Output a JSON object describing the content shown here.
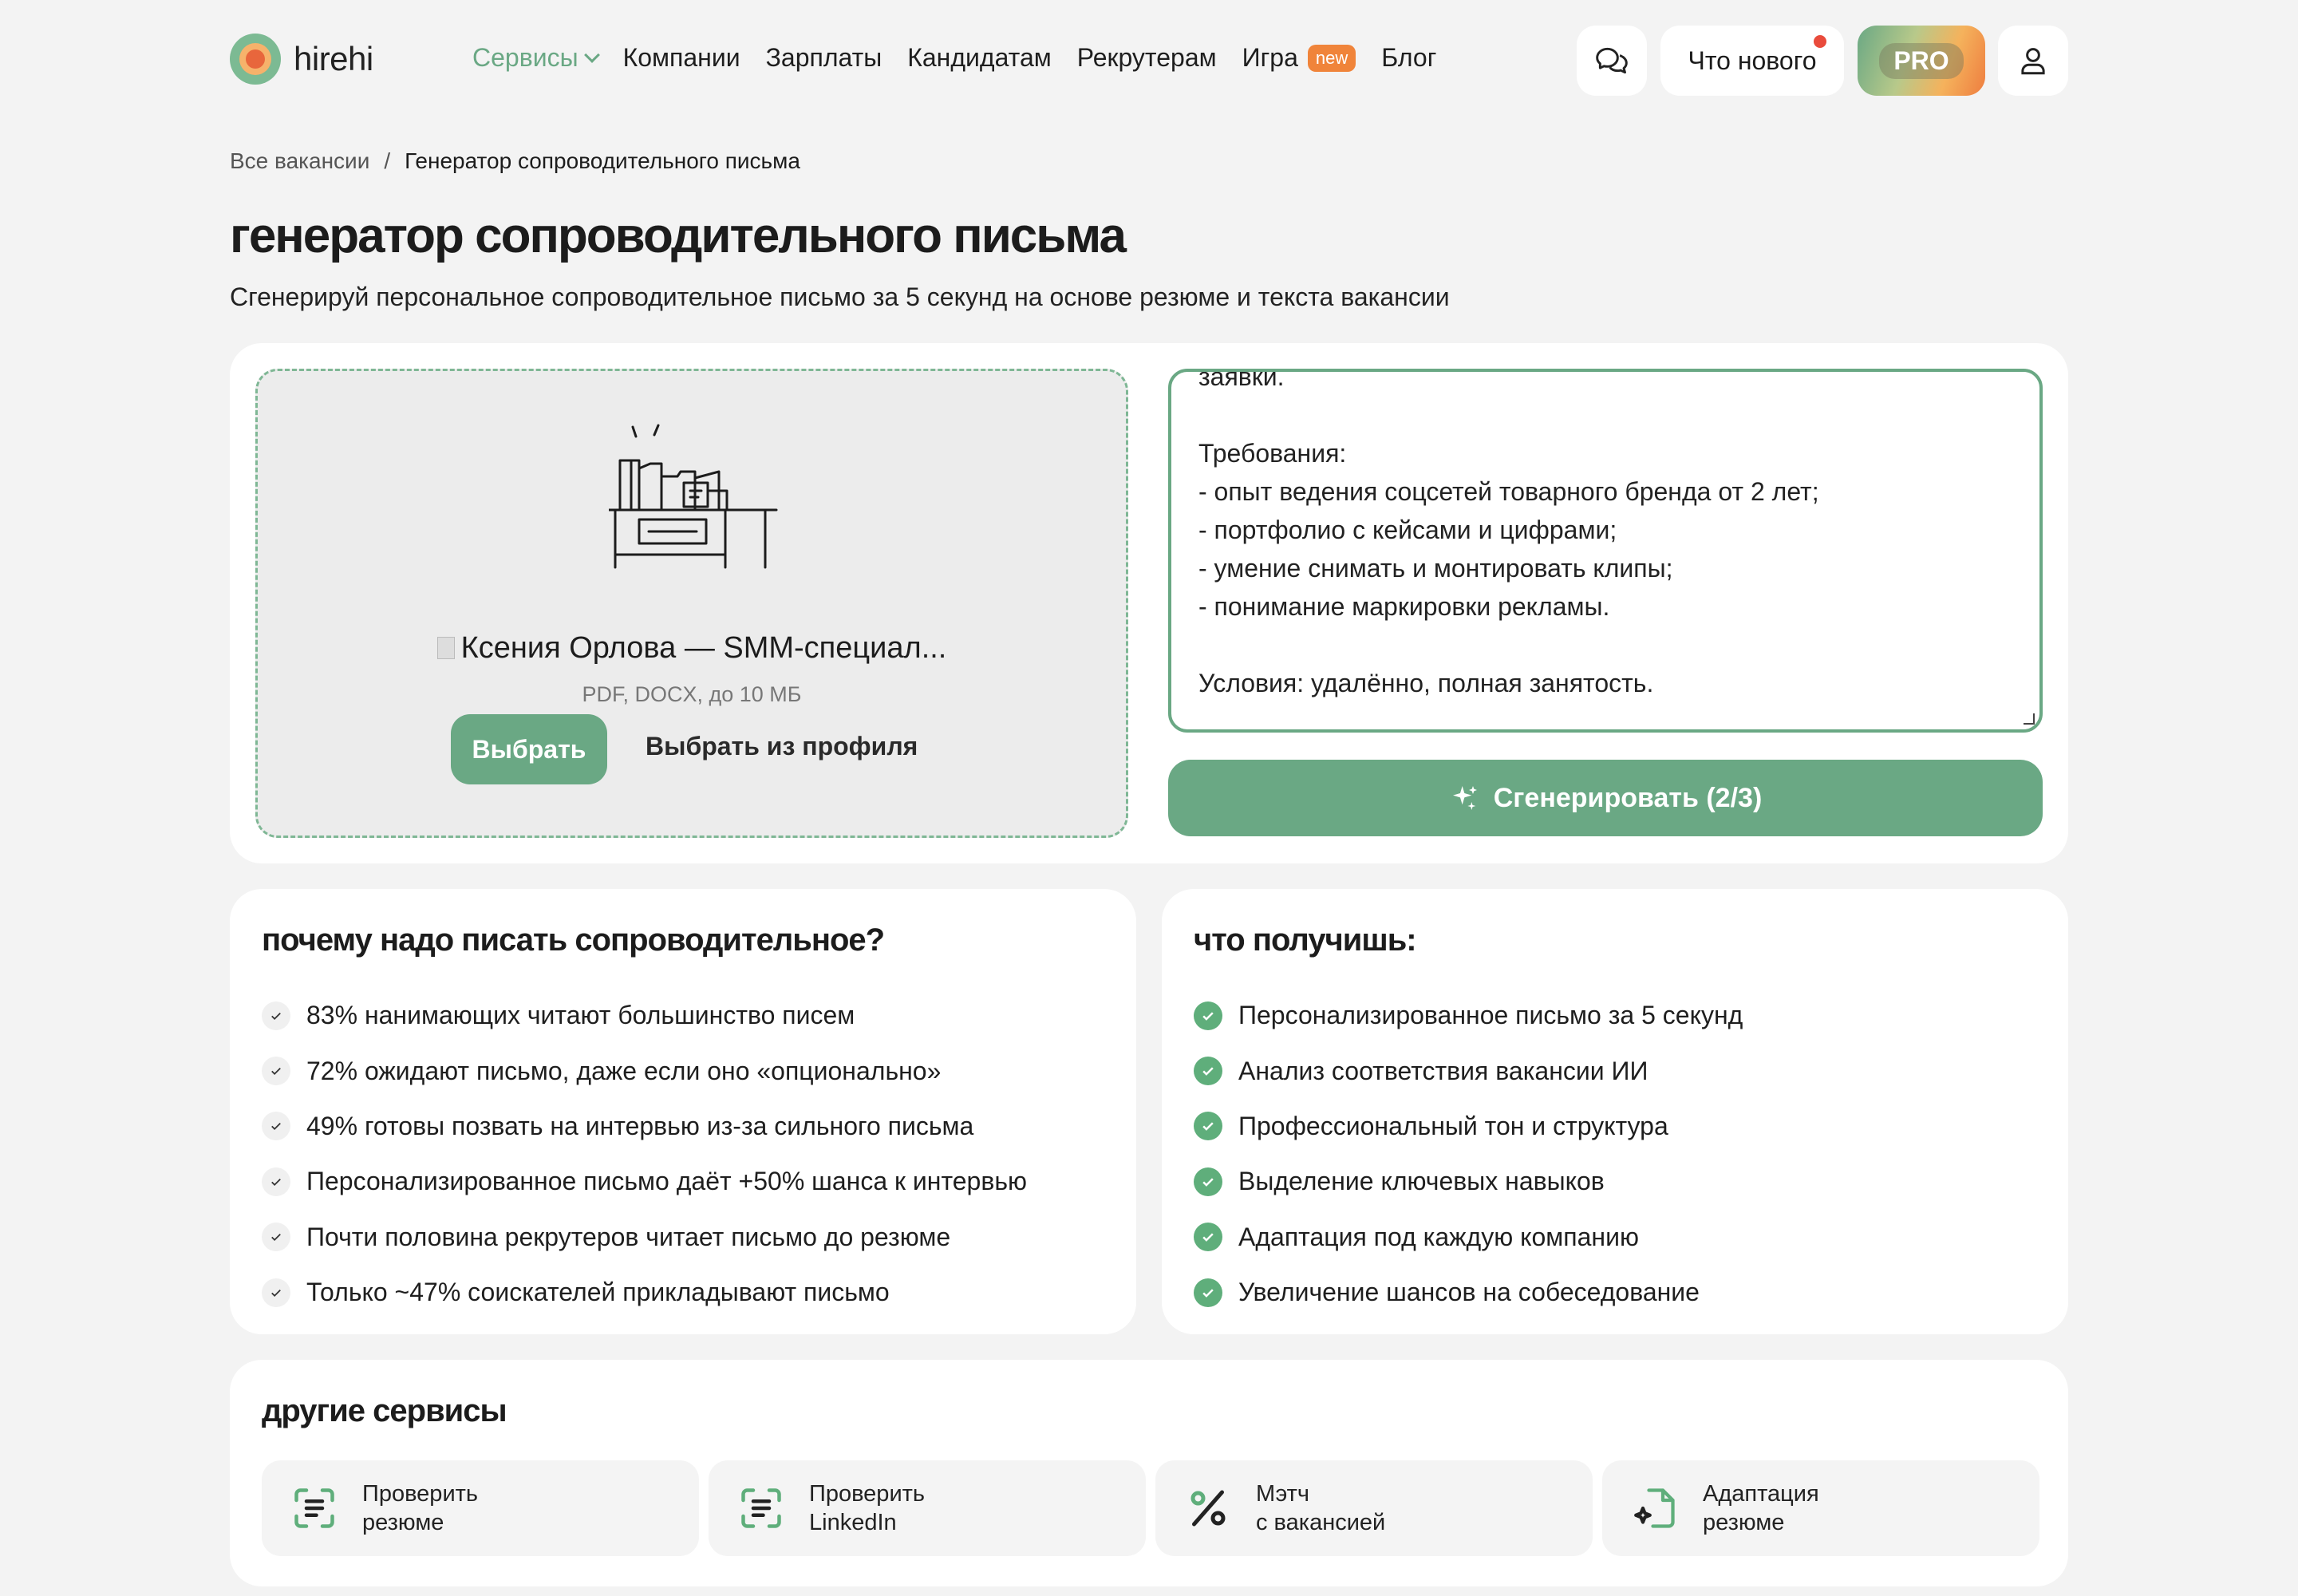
{
  "header": {
    "logo_text": "hirehi",
    "nav": [
      "Сервисы",
      "Компании",
      "Зарплаты",
      "Кандидатам",
      "Рекрутерам",
      "Игра",
      "Блог"
    ],
    "new_badge": "new",
    "whats_new": "Что нового",
    "pro": "PRO"
  },
  "breadcrumb": {
    "parent": "Все вакансии",
    "separator": "/",
    "current": "Генератор сопроводительного письма"
  },
  "page": {
    "title": "генератор сопроводительного письма",
    "subtitle": "Сгенерируй персональное сопроводительное письмо за 5 секунд на основе резюме и текста вакансии"
  },
  "upload": {
    "file_name": "Ксения Орлова — SMM-специал...",
    "hint": "PDF, DOCX, до 10 МБ",
    "choose": "Выбрать",
    "choose_profile": "Выбрать из профиля"
  },
  "vacancy_text": "заявки.\n\nТребования:\n- опыт ведения соцсетей товарного бренда от 2 лет;\n- портфолио с кейсами и цифрами;\n- умение снимать и монтировать клипы;\n- понимание маркировки рекламы.\n\nУсловия: удалённо, полная занятость.",
  "generate_button": "Сгенерировать (2/3)",
  "why": {
    "title": "почему надо писать сопроводительное?",
    "items": [
      "83% нанимающих читают большинство писем",
      "72% ожидают письмо, даже если оно «опционально»",
      "49% готовы позвать на интервью из-за сильного письма",
      "Персонализированное письмо даёт +50% шанса к интервью",
      "Почти половина рекрутеров читает письмо до резюме",
      "Только ~47% соискателей прикладывают письмо"
    ]
  },
  "get": {
    "title": "что получишь:",
    "items": [
      "Персонализированное письмо за 5 секунд",
      "Анализ соответствия вакансии ИИ",
      "Профессиональный тон и структура",
      "Выделение ключевых навыков",
      "Адаптация под каждую компанию",
      "Увеличение шансов на собеседование"
    ]
  },
  "other": {
    "title": "другие сервисы",
    "services": [
      {
        "line1": "Проверить",
        "line2": "резюме",
        "icon": "scan-doc-icon"
      },
      {
        "line1": "Проверить",
        "line2": "LinkedIn",
        "icon": "scan-doc-icon"
      },
      {
        "line1": "Мэтч",
        "line2": "с вакансией",
        "icon": "percent-icon"
      },
      {
        "line1": "Адаптация",
        "line2": "резюме",
        "icon": "doc-sparkle-icon"
      }
    ]
  },
  "colors": {
    "accent": "#6aa884",
    "check_green": "#5fae7b",
    "new_badge": "#f0843a",
    "notify_dot": "#e94b3c"
  }
}
